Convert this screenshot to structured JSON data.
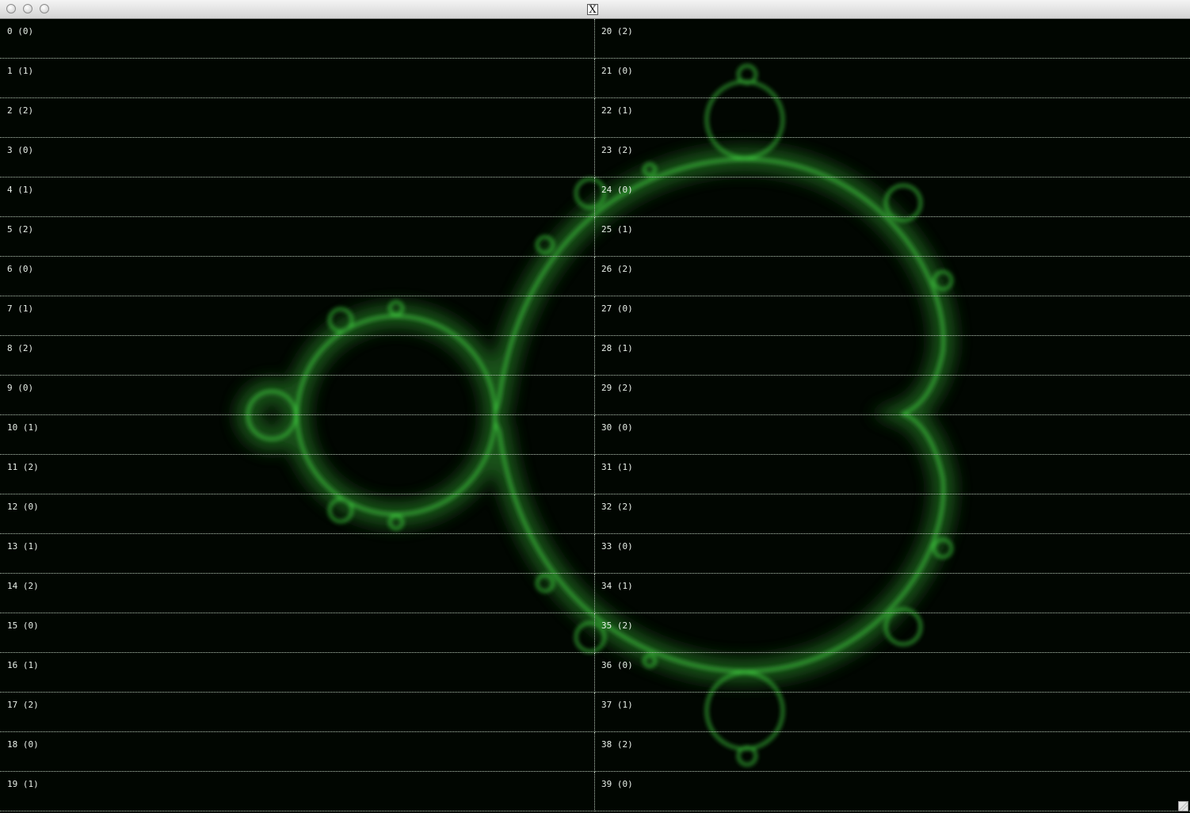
{
  "window": {
    "title_icon": "X"
  },
  "grid": {
    "columns": 2,
    "rows_per_column": 20,
    "cells": [
      {
        "label": "0 (0)"
      },
      {
        "label": "1 (1)"
      },
      {
        "label": "2 (2)"
      },
      {
        "label": "3 (0)"
      },
      {
        "label": "4 (1)"
      },
      {
        "label": "5 (2)"
      },
      {
        "label": "6 (0)"
      },
      {
        "label": "7 (1)"
      },
      {
        "label": "8 (2)"
      },
      {
        "label": "9 (0)"
      },
      {
        "label": "10 (1)"
      },
      {
        "label": "11 (2)"
      },
      {
        "label": "12 (0)"
      },
      {
        "label": "13 (1)"
      },
      {
        "label": "14 (2)"
      },
      {
        "label": "15 (0)"
      },
      {
        "label": "16 (1)"
      },
      {
        "label": "17 (2)"
      },
      {
        "label": "18 (0)"
      },
      {
        "label": "19 (1)"
      },
      {
        "label": "20 (2)"
      },
      {
        "label": "21 (0)"
      },
      {
        "label": "22 (1)"
      },
      {
        "label": "23 (2)"
      },
      {
        "label": "24 (0)"
      },
      {
        "label": "25 (1)"
      },
      {
        "label": "26 (2)"
      },
      {
        "label": "27 (0)"
      },
      {
        "label": "28 (1)"
      },
      {
        "label": "29 (2)"
      },
      {
        "label": "30 (0)"
      },
      {
        "label": "31 (1)"
      },
      {
        "label": "32 (2)"
      },
      {
        "label": "33 (0)"
      },
      {
        "label": "34 (1)"
      },
      {
        "label": "35 (2)"
      },
      {
        "label": "36 (0)"
      },
      {
        "label": "37 (1)"
      },
      {
        "label": "38 (2)"
      },
      {
        "label": "39 (0)"
      }
    ]
  },
  "colors": {
    "background": "#010601",
    "fractal_edge": "#3fd23f",
    "fractal_glow": "#1a5c1a",
    "grid_lines": "#b9c9b9",
    "label_text": "#e8efe8"
  },
  "icons": {
    "close": "close-icon",
    "minimize": "minimize-icon",
    "zoom": "zoom-icon",
    "x11": "x11-icon",
    "resize": "resize-grip-icon"
  }
}
